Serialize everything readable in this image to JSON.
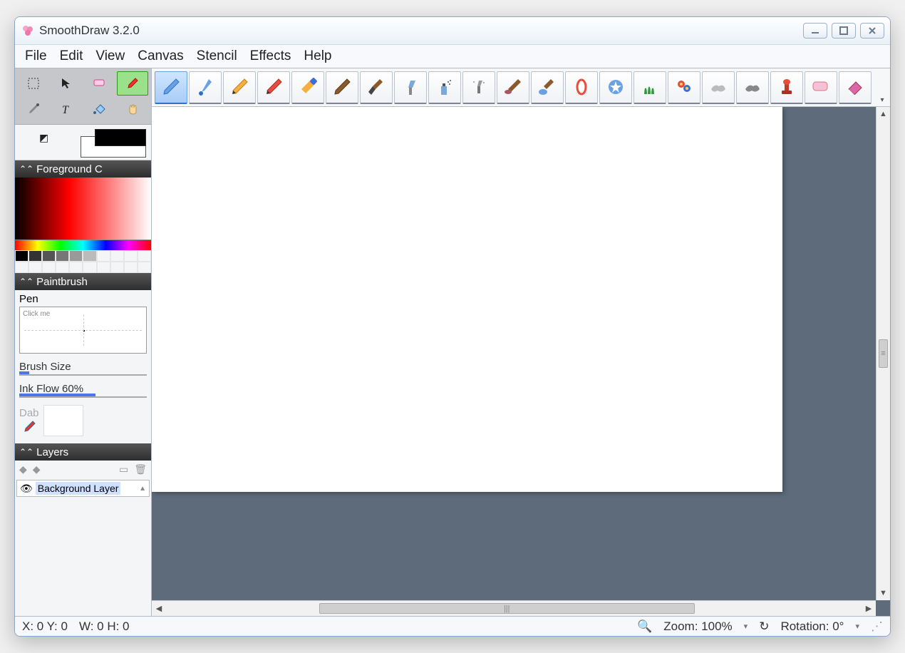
{
  "title": "SmoothDraw 3.2.0",
  "menu": [
    "File",
    "Edit",
    "View",
    "Canvas",
    "Stencil",
    "Effects",
    "Help"
  ],
  "tools": [
    {
      "name": "select-rect-tool",
      "selected": false
    },
    {
      "name": "arrow-tool",
      "selected": false
    },
    {
      "name": "eraser-small-tool",
      "selected": false
    },
    {
      "name": "brush-tool",
      "selected": true
    },
    {
      "name": "eyedropper-tool",
      "selected": false
    },
    {
      "name": "text-tool",
      "selected": false
    },
    {
      "name": "fill-bucket-tool",
      "selected": false
    },
    {
      "name": "hand-pan-tool",
      "selected": false
    }
  ],
  "brushes": [
    "pen-brush",
    "ink-brush",
    "pencil-brush",
    "red-pencil-brush",
    "felt-pen-brush",
    "brown-brush",
    "paintbrush-brush",
    "fan-brush",
    "spray-brush",
    "dust-brush",
    "smudge-brush",
    "wet-brush",
    "oil-brush",
    "star-brush",
    "grass-brush",
    "flower-brush",
    "sponge-brush",
    "chalk-brush",
    "stamp-brush",
    "eraser-soft-brush",
    "eraser-hard-brush"
  ],
  "brush_active_index": 0,
  "panels": {
    "foreground_title": "Foreground C",
    "paintbrush_title": "Paintbrush",
    "layers_title": "Layers"
  },
  "paintbrush": {
    "pen_label": "Pen",
    "click_me": "Click me",
    "brush_size_label": "Brush Size",
    "brush_size_pct": 8,
    "ink_flow_label": "Ink Flow 60%",
    "ink_flow_pct": 60,
    "dab_label": "Dab"
  },
  "layers": {
    "item_label": "Background Layer"
  },
  "status": {
    "xy": "X: 0 Y: 0",
    "wh": "W: 0 H: 0",
    "zoom": "Zoom: 100%",
    "rotation": "Rotation: 0°"
  },
  "palette_greys": [
    "#000000",
    "#333333",
    "#555555",
    "#777777",
    "#999999",
    "#bbbbbb",
    "#ffffff",
    "#ffffff",
    "#ffffff",
    "#ffffff"
  ],
  "palette_whites": [
    "#ffffff",
    "#ffffff",
    "#ffffff",
    "#ffffff",
    "#ffffff",
    "#ffffff",
    "#ffffff",
    "#ffffff",
    "#ffffff",
    "#ffffff"
  ]
}
